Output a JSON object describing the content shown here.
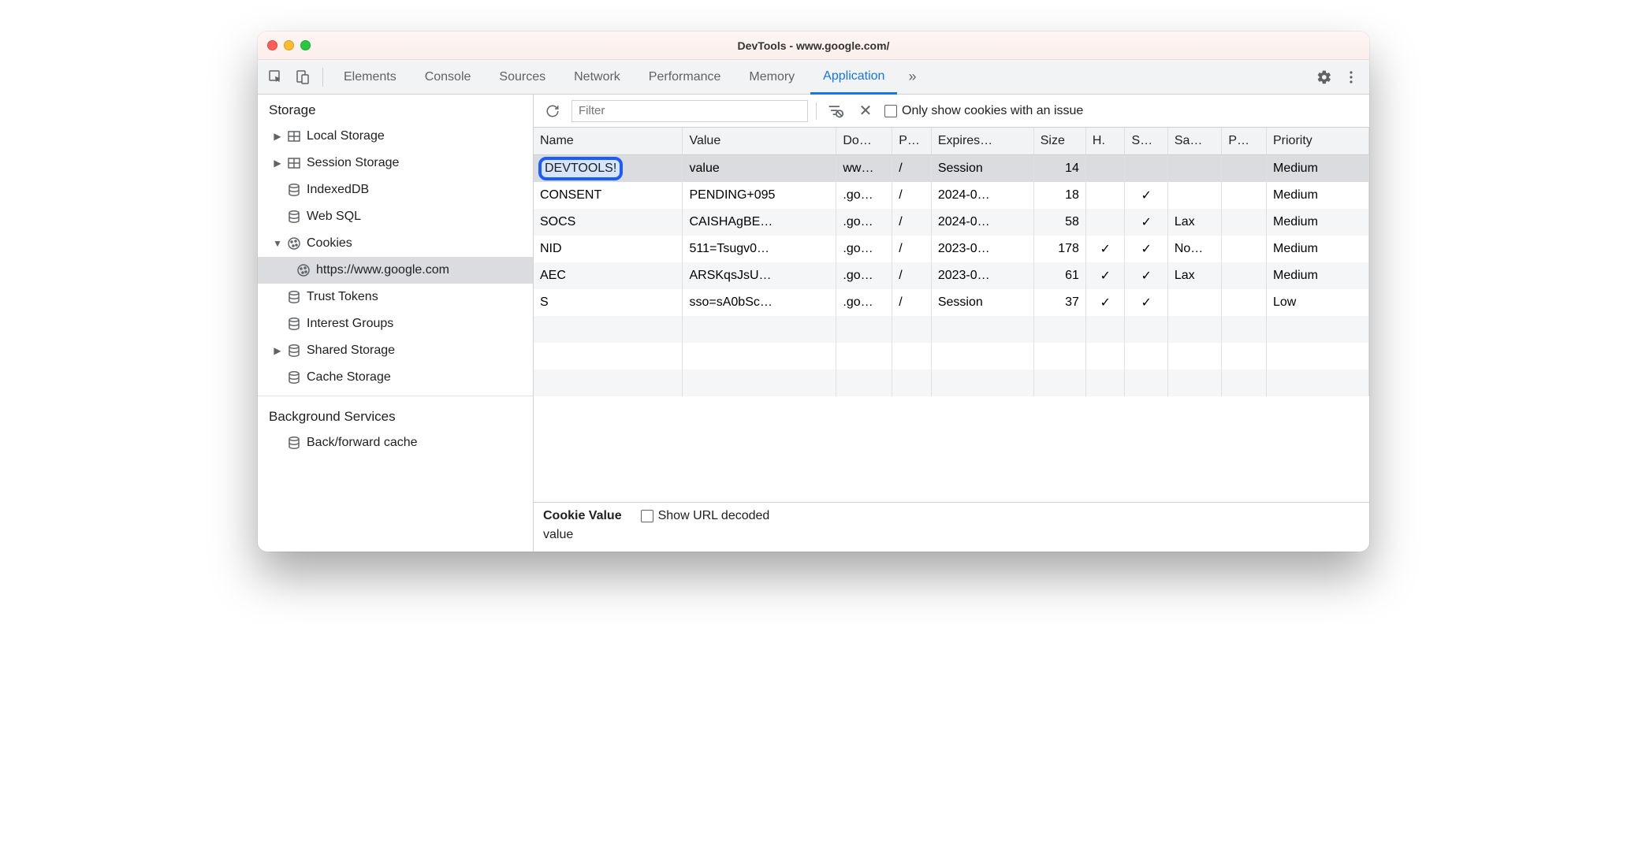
{
  "title": "DevTools - www.google.com/",
  "tabs": [
    "Elements",
    "Console",
    "Sources",
    "Network",
    "Performance",
    "Memory",
    "Application"
  ],
  "active_tab": "Application",
  "sidebar": {
    "section1": "Storage",
    "items": [
      {
        "label": "Local Storage",
        "arrow": "▶"
      },
      {
        "label": "Session Storage",
        "arrow": "▶"
      },
      {
        "label": "IndexedDB"
      },
      {
        "label": "Web SQL"
      },
      {
        "label": "Cookies",
        "arrow": "▼",
        "children": [
          {
            "label": "https://www.google.com",
            "selected": true
          }
        ]
      },
      {
        "label": "Trust Tokens"
      },
      {
        "label": "Interest Groups"
      },
      {
        "label": "Shared Storage",
        "arrow": "▶"
      },
      {
        "label": "Cache Storage"
      }
    ],
    "section2": "Background Services",
    "items2": [
      {
        "label": "Back/forward cache"
      }
    ]
  },
  "toolbar": {
    "filter_placeholder": "Filter",
    "only_issue_label": "Only show cookies with an issue"
  },
  "columns": [
    "Name",
    "Value",
    "Do…",
    "P…",
    "Expires…",
    "Size",
    "H.",
    "S…",
    "Sa…",
    "P…",
    "Priority"
  ],
  "col_widths": [
    "160px",
    "165px",
    "60px",
    "42px",
    "110px",
    "56px",
    "42px",
    "46px",
    "58px",
    "48px",
    "110px"
  ],
  "rows": [
    {
      "name": "DEVTOOLS!",
      "editing": true,
      "value": "value",
      "domain": "ww…",
      "path": "/",
      "expires": "Session",
      "size": "14",
      "h": "",
      "s": "",
      "sa": "",
      "p": "",
      "priority": "Medium",
      "selected": true
    },
    {
      "name": "CONSENT",
      "value": "PENDING+095",
      "domain": ".go…",
      "path": "/",
      "expires": "2024-0…",
      "size": "18",
      "h": "",
      "s": "✓",
      "sa": "",
      "p": "",
      "priority": "Medium"
    },
    {
      "name": "SOCS",
      "value": "CAISHAgBE…",
      "domain": ".go…",
      "path": "/",
      "expires": "2024-0…",
      "size": "58",
      "h": "",
      "s": "✓",
      "sa": "Lax",
      "p": "",
      "priority": "Medium"
    },
    {
      "name": "NID",
      "value": "511=Tsugv0…",
      "domain": ".go…",
      "path": "/",
      "expires": "2023-0…",
      "size": "178",
      "h": "✓",
      "s": "✓",
      "sa": "No…",
      "p": "",
      "priority": "Medium"
    },
    {
      "name": "AEC",
      "value": "ARSKqsJsU…",
      "domain": ".go…",
      "path": "/",
      "expires": "2023-0…",
      "size": "61",
      "h": "✓",
      "s": "✓",
      "sa": "Lax",
      "p": "",
      "priority": "Medium"
    },
    {
      "name": "S",
      "value": "sso=sA0bSc…",
      "domain": ".go…",
      "path": "/",
      "expires": "Session",
      "size": "37",
      "h": "✓",
      "s": "✓",
      "sa": "",
      "p": "",
      "priority": "Low"
    }
  ],
  "detail": {
    "label": "Cookie Value",
    "decode_label": "Show URL decoded",
    "value": "value"
  }
}
